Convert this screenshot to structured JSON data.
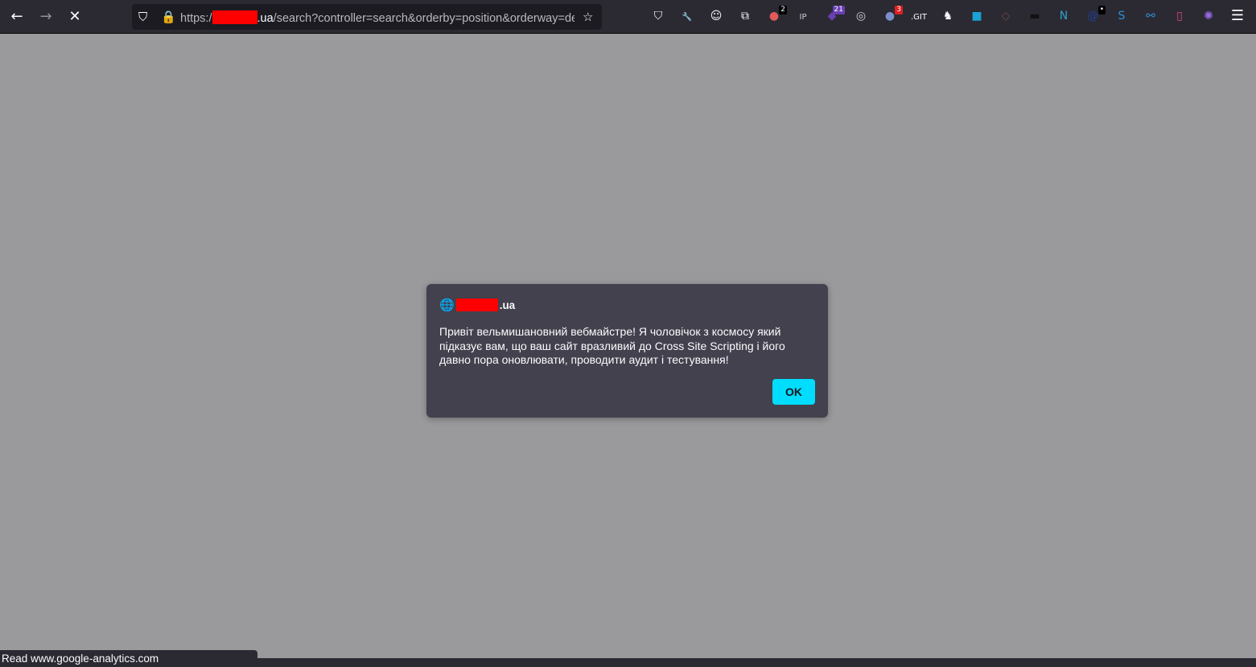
{
  "toolbar": {
    "url_prefix": "https:/",
    "url_host_suffix": ".ua",
    "url_path": "/search?controller=search&orderby=position&orderway=desc&search_query=",
    "extensions": [
      {
        "name": "pocket-icon",
        "glyph": "⛉",
        "color": "#fbfbfe"
      },
      {
        "name": "wrench-icon",
        "glyph": "🔧",
        "color": "#fbfbfe"
      },
      {
        "name": "account-icon",
        "glyph": "☺",
        "color": "#fbfbfe"
      },
      {
        "name": "extensions-icon",
        "glyph": "⧉",
        "color": "#fbfbfe"
      },
      {
        "name": "extension-dots-icon",
        "glyph": "●",
        "color": "#e05a5a",
        "badge": "2",
        "badge_color": "#000000"
      },
      {
        "name": "ip-icon",
        "glyph": "IP",
        "color": "#cfcfd8"
      },
      {
        "name": "extension-purple-icon",
        "glyph": "◆",
        "color": "#6a3fb5",
        "badge": "21",
        "badge_color": "#6a3fb5"
      },
      {
        "name": "cookie-icon",
        "glyph": "◎",
        "color": "#cfcfd8"
      },
      {
        "name": "extension-globe-icon",
        "glyph": "●",
        "color": "#7a8fc9",
        "badge": "3",
        "badge_color": "#e02020"
      },
      {
        "name": "git-icon",
        "glyph": ".GIT",
        "color": "#fbfbfe"
      },
      {
        "name": "extension-mask-icon",
        "glyph": "♞",
        "color": "#fbfbfe"
      },
      {
        "name": "extension-camera-icon",
        "glyph": "■",
        "color": "#1ba3d6"
      },
      {
        "name": "extension-diamond-icon",
        "glyph": "◇",
        "color": "#6a4a40"
      },
      {
        "name": "extension-hat-icon",
        "glyph": "▬",
        "color": "#111111"
      },
      {
        "name": "extension-n-icon",
        "glyph": "N",
        "color": "#2aa3c8"
      },
      {
        "name": "extension-at-icon",
        "glyph": "@",
        "color": "#1e3f9a",
        "badge": "•",
        "badge_color": "#000000"
      },
      {
        "name": "extension-s-icon",
        "glyph": "S",
        "color": "#2d8fd5"
      },
      {
        "name": "extension-link-icon",
        "glyph": "⚯",
        "color": "#2d8fd5"
      },
      {
        "name": "extension-doc-icon",
        "glyph": "▯",
        "color": "#e0457b"
      },
      {
        "name": "extension-gear-icon",
        "glyph": "✺",
        "color": "#9a6ae8"
      }
    ]
  },
  "dialog": {
    "origin_suffix": ".ua",
    "message": "Привіт вельмишановний вебмайстре! Я чоловічок з космосу який підказує вам, що ваш сайт вразливий до Cross Site Scripting і його давно пора оновлювати, проводити аудит і тестування!",
    "ok_label": "OK"
  },
  "status": {
    "text": "Read www.google-analytics.com"
  }
}
